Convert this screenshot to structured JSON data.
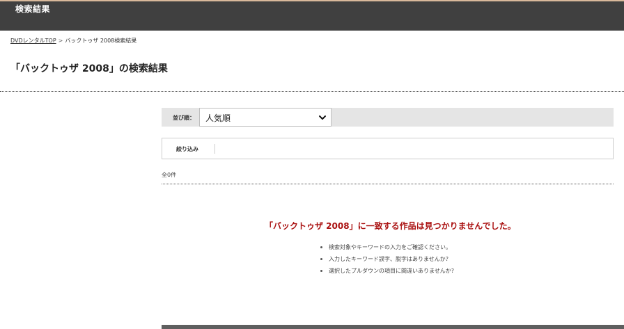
{
  "header": {
    "title": "検索結果"
  },
  "breadcrumb": {
    "home_link": "DVDレンタルTOP",
    "separator": ">",
    "current": "バックトゥザ 2008検索結果"
  },
  "page": {
    "title": "「バックトゥザ 2008」の検索結果"
  },
  "sort": {
    "label": "並び順：",
    "selected": "人気順"
  },
  "filter": {
    "label": "絞り込み"
  },
  "results": {
    "count_text": "全0件",
    "no_result_message": "「バックトゥザ 2008」に一致する作品は見つかりませんでした。",
    "hints": [
      "検索対象やキーワードの入力をご確認ください。",
      "入力したキーワード誤字、脱字はありませんか？",
      "選択したプルダウンの項目に間違いありませんか?"
    ]
  },
  "colors": {
    "header_bg": "#404040",
    "header_accent": "#d9b99b",
    "error_text": "#aa1111",
    "sort_bar_bg": "#e5e5e5"
  },
  "icons": {
    "sort_dropdown": "chevron-down-icon"
  }
}
